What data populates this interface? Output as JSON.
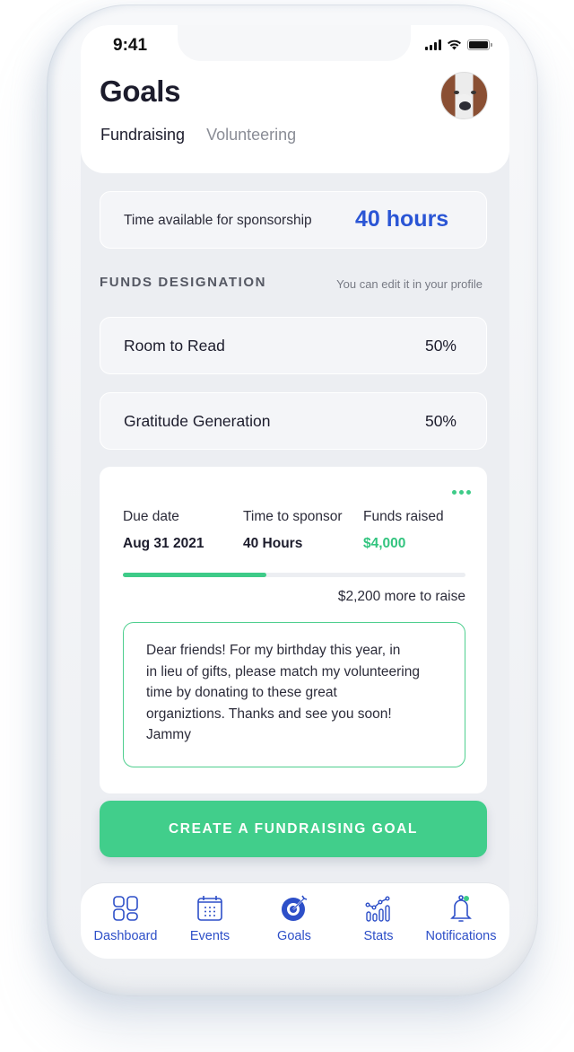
{
  "status_bar": {
    "time": "9:41"
  },
  "header": {
    "title": "Goals",
    "tabs": [
      {
        "label": "Fundraising",
        "active": true
      },
      {
        "label": "Volunteering",
        "active": false
      }
    ],
    "avatar_alt": "User avatar (dog photo)"
  },
  "sponsorship": {
    "label": "Time available for sponsorship",
    "value": "40 hours"
  },
  "funds_designation": {
    "title": "FUNDS DESIGNATION",
    "hint": "You can edit it in your profile",
    "items": [
      {
        "name": "Room to Read",
        "percent": "50%"
      },
      {
        "name": "Gratitude Generation",
        "percent": "50%"
      }
    ]
  },
  "goal": {
    "stats": [
      {
        "label": "Due date",
        "value": "Aug 31 2021"
      },
      {
        "label": "Time to sponsor",
        "value": "40 Hours"
      },
      {
        "label": "Funds raised",
        "value": "$4,000"
      }
    ],
    "progress_fraction": 0.42,
    "remaining": "$2,200 more to raise",
    "message": "Dear friends! For my  birthday this year, in\nin lieu of gifts, please match my volunteering\ntime by donating to these great\norganiztions. Thanks and see you soon!\nJammy"
  },
  "cta": {
    "label": "CREATE A FUNDRAISING GOAL"
  },
  "nav": {
    "items": [
      {
        "label": "Dashboard",
        "icon": "dashboard-icon"
      },
      {
        "label": "Events",
        "icon": "calendar-icon"
      },
      {
        "label": "Goals",
        "icon": "target-icon",
        "active": true
      },
      {
        "label": "Stats",
        "icon": "stats-icon"
      },
      {
        "label": "Notifications",
        "icon": "bell-icon",
        "badge": true
      }
    ]
  },
  "colors": {
    "accent_blue": "#2a55d5",
    "accent_green": "#41ce8b",
    "nav_blue": "#2d4fc8"
  }
}
